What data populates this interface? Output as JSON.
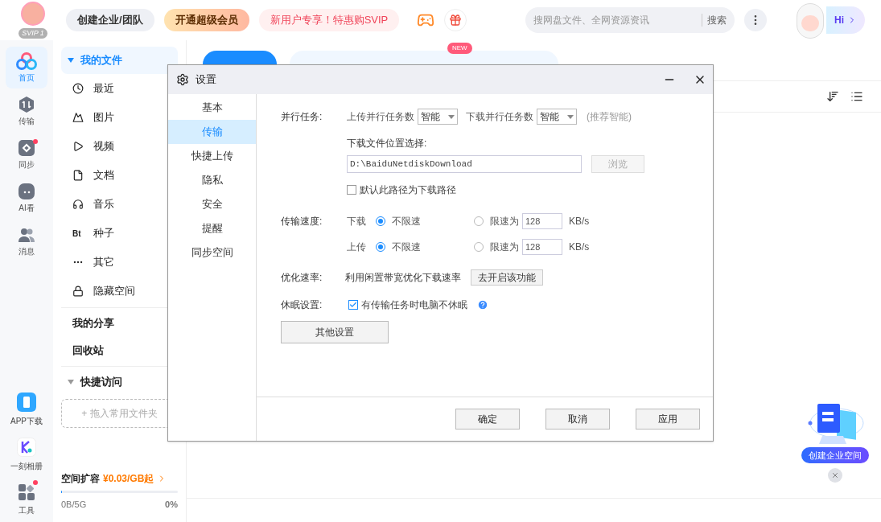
{
  "header": {
    "avatar_badge": "SVIP 1",
    "buttons": [
      {
        "label": "创建企业/团队",
        "kind": "plain"
      },
      {
        "label": "开通超级会员",
        "kind": "gold"
      },
      {
        "label": "新用户专享！特惠购SVIP",
        "kind": "promo"
      }
    ],
    "search": {
      "placeholder": "搜网盘文件、全网资源资讯",
      "button": "搜索"
    },
    "greeting": "Hi"
  },
  "rail": {
    "items": [
      {
        "label": "首页",
        "selected": true,
        "dot": false
      },
      {
        "label": "传输",
        "selected": false,
        "dot": false
      },
      {
        "label": "同步",
        "selected": false,
        "dot": true
      },
      {
        "label": "AI看",
        "selected": false,
        "dot": false
      },
      {
        "label": "消息",
        "selected": false,
        "dot": false
      }
    ],
    "bottom": [
      {
        "label": "APP下载",
        "dot": false
      },
      {
        "label": "一刻相册",
        "dot": false
      },
      {
        "label": "工具",
        "dot": true
      }
    ]
  },
  "sidebar": {
    "my_files": {
      "label": "我的文件",
      "expanded": true,
      "children": [
        {
          "label": "最近"
        },
        {
          "label": "图片"
        },
        {
          "label": "视频"
        },
        {
          "label": "文档"
        },
        {
          "label": "音乐"
        },
        {
          "label": "种子",
          "glyph": "Bt"
        },
        {
          "label": "其它"
        },
        {
          "label": "隐藏空间"
        }
      ]
    },
    "links": [
      "我的分享",
      "回收站"
    ],
    "quick": {
      "label": "快捷访问",
      "expanded": true,
      "drop_hint": "+ 拖入常用文件夹"
    },
    "storage": {
      "label": "空间扩容",
      "price": "¥0.03/GB起",
      "used": "0B/5G",
      "percent": "0%",
      "level": 0.01
    }
  },
  "toolbar": {
    "new_badge": "NEW"
  },
  "promo": {
    "label": "创建企业空间"
  },
  "dialog": {
    "title": "设置",
    "nav": [
      {
        "label": "基本",
        "selected": false
      },
      {
        "label": "传输",
        "selected": true
      },
      {
        "label": "快捷上传",
        "selected": false
      },
      {
        "label": "隐私",
        "selected": false
      },
      {
        "label": "安全",
        "selected": false
      },
      {
        "label": "提醒",
        "selected": false
      },
      {
        "label": "同步空间",
        "selected": false
      }
    ],
    "parallel": {
      "label": "并行任务:",
      "upload_label": "上传并行任务数",
      "upload_value": "智能",
      "download_label": "下载并行任务数",
      "download_value": "智能",
      "hint": "(推荐智能)"
    },
    "location": {
      "label": "下载文件位置选择:",
      "path": "D:\\BaiduNetdiskDownload",
      "browse": "浏览",
      "default_label": "默认此路径为下载路径",
      "default_checked": false
    },
    "speed": {
      "label": "传输速度:",
      "rows": [
        {
          "label": "下载",
          "options": [
            {
              "label": "不限速",
              "selected": true
            },
            {
              "label": "限速为",
              "selected": false
            }
          ],
          "value": "128",
          "unit": "KB/s"
        },
        {
          "label": "上传",
          "options": [
            {
              "label": "不限速",
              "selected": true
            },
            {
              "label": "限速为",
              "selected": false
            }
          ],
          "value": "128",
          "unit": "KB/s"
        }
      ]
    },
    "optimize": {
      "label": "优化速率:",
      "text": "利用闲置带宽优化下载速率",
      "button": "去开启该功能"
    },
    "sleep": {
      "label": "休眠设置:",
      "text": "有传输任务时电脑不休眠",
      "checked": true
    },
    "other": "其他设置",
    "footer": [
      "确定",
      "取消",
      "应用"
    ]
  }
}
